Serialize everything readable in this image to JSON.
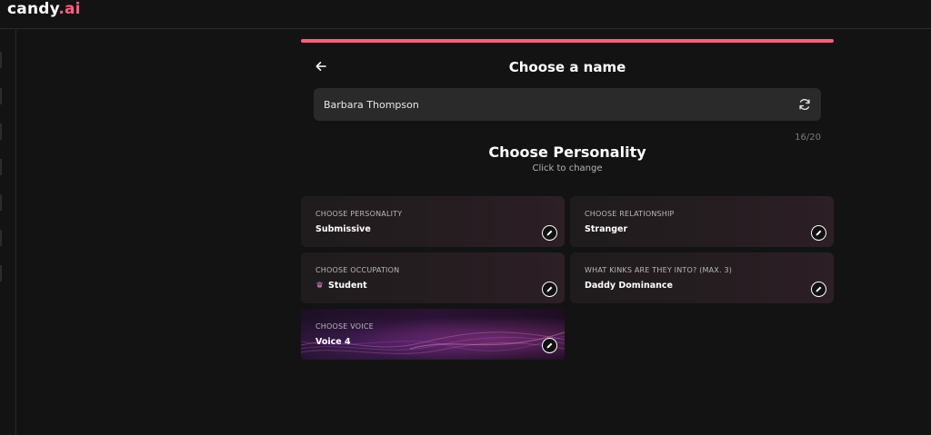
{
  "brand": {
    "name": "candy",
    "suffix": ".ai",
    "accent": "#f0647a"
  },
  "header": {
    "title": "Choose a name"
  },
  "name_input": {
    "value": "Barbara Thompson",
    "counter": "16/20"
  },
  "personality_section": {
    "title": "Choose Personality",
    "subtitle": "Click to change"
  },
  "cards": [
    {
      "label": "CHOOSE PERSONALITY",
      "value": "Submissive"
    },
    {
      "label": "CHOOSE RELATIONSHIP",
      "value": "Stranger"
    },
    {
      "label": "CHOOSE OCCUPATION",
      "value": "Student",
      "icon": "graduation-icon"
    },
    {
      "label": "WHAT KINKS ARE THEY INTO? (MAX. 3)",
      "value": "Daddy Dominance"
    },
    {
      "label": "CHOOSE VOICE",
      "value": "Voice 4"
    }
  ]
}
